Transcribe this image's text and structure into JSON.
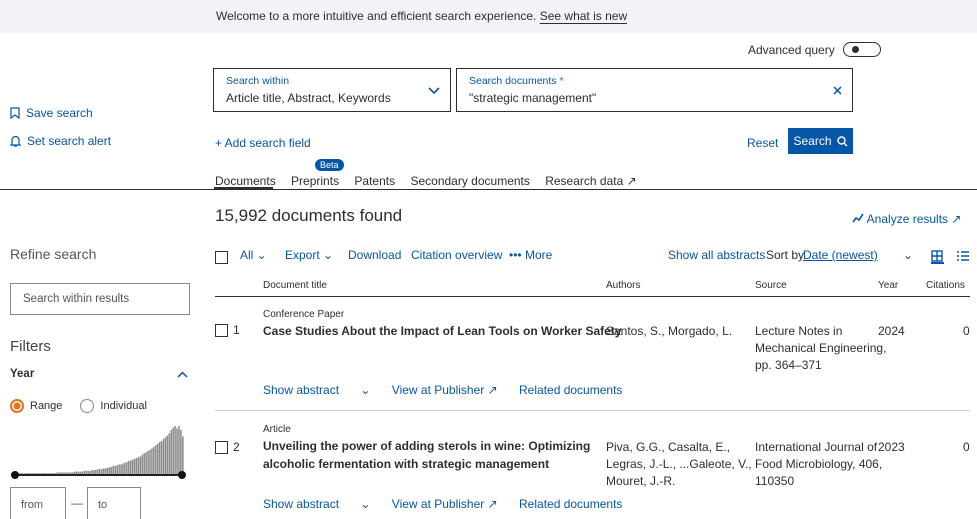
{
  "banner": {
    "text": "Welcome to a more intuitive and efficient search experience.",
    "link": "See what is new"
  },
  "advanced_query": "Advanced query",
  "search_within": {
    "label": "Search within",
    "value": "Article title, Abstract, Keywords"
  },
  "search_documents": {
    "label": "Search documents",
    "required_mark": "*",
    "value": "\"strategic management\""
  },
  "add_field": "+ Add search field",
  "reset": "Reset",
  "search_btn": "Search",
  "sidebar": {
    "save_search": "Save search",
    "set_alert": "Set search alert"
  },
  "tabs": {
    "items": [
      "Documents",
      "Preprints",
      "Patents",
      "Secondary documents",
      "Research data ↗"
    ],
    "beta": "Beta"
  },
  "results": {
    "count": "15,992 documents found",
    "analyze": "Analyze results ↗"
  },
  "refine": {
    "title": "Refine search",
    "search_placeholder": "Search within results",
    "filters": "Filters",
    "year": "Year",
    "range": "Range",
    "individual": "Individual",
    "from": "from",
    "to": "to",
    "dash": "—"
  },
  "histogram": [
    1,
    1,
    1,
    1,
    1,
    1,
    1,
    1,
    1,
    1,
    1,
    1,
    1,
    1,
    1,
    1,
    1,
    1,
    1,
    1,
    1,
    1,
    2,
    2,
    2,
    2,
    2,
    2,
    2,
    2,
    2,
    3,
    3,
    3,
    3,
    3,
    4,
    4,
    4,
    4,
    5,
    5,
    5,
    6,
    6,
    6,
    7,
    7,
    8,
    8,
    9,
    10,
    10,
    11,
    12,
    12,
    13,
    14,
    15,
    16,
    17,
    18,
    19,
    20,
    21,
    22,
    24,
    26,
    27,
    29,
    30,
    32,
    34,
    36,
    38,
    40,
    41,
    44,
    46,
    48,
    51,
    55,
    58,
    60,
    57,
    60,
    55,
    47
  ],
  "toolbar": {
    "all": "All",
    "export": "Export",
    "download": "Download",
    "citation_overview": "Citation overview",
    "more": "More",
    "show_abstracts": "Show all abstracts",
    "sort_by": "Sort by",
    "sort_value": "Date (newest)"
  },
  "columns": {
    "title": "Document title",
    "authors": "Authors",
    "source": "Source",
    "year": "Year",
    "citations": "Citations"
  },
  "rows": [
    {
      "num": "1",
      "type": "Conference Paper",
      "title": "Case Studies About the Impact of Lean Tools on Worker Safety",
      "title2": "",
      "authors": "Santos, S., Morgado, L.",
      "authors2": "",
      "authors3": "",
      "source": "Lecture Notes in",
      "source2": "Mechanical Engineering,",
      "source3": "pp. 364–371",
      "year": "2024",
      "citations": "0"
    },
    {
      "num": "2",
      "type": "Article",
      "title": "Unveiling the power of adding sterols in wine: Optimizing",
      "title2": "alcoholic fermentation with strategic management",
      "authors": "Piva, G.G., Casalta, E.,",
      "authors2": "Legras, J.-L., ...Galeote, V.,",
      "authors3": "Mouret, J.-R.",
      "source": "International Journal of",
      "source2": "Food Microbiology, 406,",
      "source3": "110350",
      "year": "2023",
      "citations": "0"
    }
  ],
  "row_actions": {
    "show_abstract": "Show abstract",
    "view_publisher": "View at Publisher ↗",
    "related": "Related documents"
  }
}
